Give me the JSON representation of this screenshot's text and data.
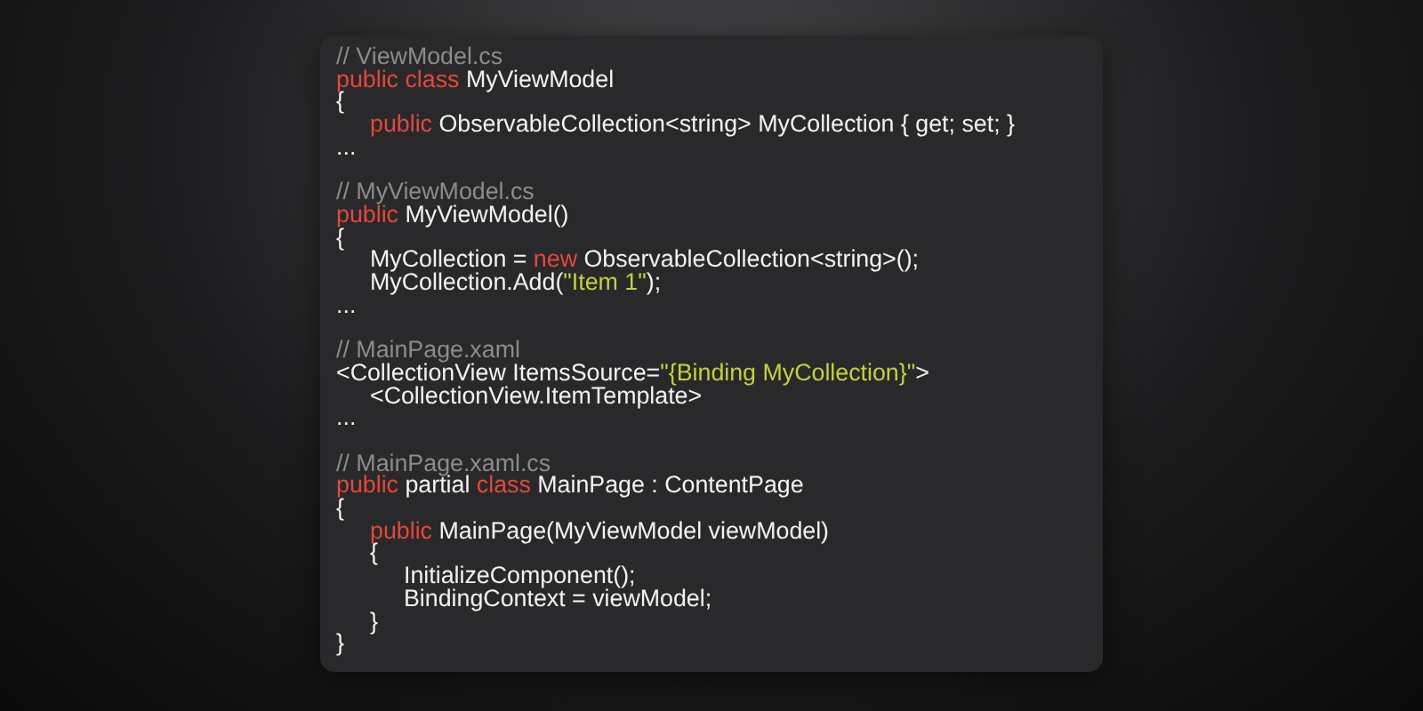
{
  "snippets": [
    {
      "lines": [
        {
          "tokens": [
            {
              "kind": "comment",
              "text": "// ViewModel.cs"
            }
          ]
        },
        {
          "tokens": [
            {
              "kind": "keyword",
              "text": "public class"
            },
            {
              "kind": "plain",
              "text": " MyViewModel"
            }
          ]
        },
        {
          "tokens": [
            {
              "kind": "plain",
              "text": "{"
            }
          ],
          "children": [
            {
              "tokens": [
                {
                  "kind": "keyword",
                  "text": "public"
                },
                {
                  "kind": "plain",
                  "text": " ObservableCollection<string> MyCollection { get; set; }"
                }
              ]
            }
          ]
        },
        {
          "tokens": [
            {
              "kind": "plain",
              "text": "..."
            }
          ]
        }
      ]
    },
    {
      "lines": [
        {
          "tokens": [
            {
              "kind": "comment",
              "text": "// MyViewModel.cs"
            }
          ]
        },
        {
          "tokens": [
            {
              "kind": "keyword",
              "text": "public"
            },
            {
              "kind": "plain",
              "text": " MyViewModel()"
            }
          ]
        },
        {
          "tokens": [
            {
              "kind": "plain",
              "text": "{"
            }
          ],
          "children": [
            {
              "tokens": [
                {
                  "kind": "plain",
                  "text": "MyCollection = "
                },
                {
                  "kind": "keyword",
                  "text": "new"
                },
                {
                  "kind": "plain",
                  "text": " ObservableCollection<string>();"
                }
              ]
            },
            {
              "tokens": [
                {
                  "kind": "plain",
                  "text": "MyCollection.Add("
                },
                {
                  "kind": "string",
                  "text": "\"Item 1\""
                },
                {
                  "kind": "plain",
                  "text": ");"
                }
              ]
            }
          ]
        },
        {
          "tokens": [
            {
              "kind": "plain",
              "text": "..."
            }
          ]
        }
      ]
    },
    {
      "lines": [
        {
          "tokens": [
            {
              "kind": "comment",
              "text": "// MainPage.xaml"
            }
          ]
        },
        {
          "tokens": [
            {
              "kind": "plain",
              "text": "<CollectionView ItemsSource="
            },
            {
              "kind": "string",
              "text": "\"{Binding MyCollection}\""
            },
            {
              "kind": "plain",
              "text": ">"
            }
          ],
          "children": [
            {
              "tokens": [
                {
                  "kind": "plain",
                  "text": "<CollectionView.ItemTemplate>"
                }
              ]
            }
          ]
        },
        {
          "tokens": [
            {
              "kind": "plain",
              "text": "..."
            }
          ]
        }
      ]
    },
    {
      "lines": [
        {
          "tokens": [
            {
              "kind": "comment",
              "text": "// MainPage.xaml.cs"
            }
          ]
        },
        {
          "tokens": [
            {
              "kind": "keyword",
              "text": "public"
            },
            {
              "kind": "plain",
              "text": " partial "
            },
            {
              "kind": "keyword",
              "text": "class"
            },
            {
              "kind": "plain",
              "text": " MainPage : ContentPage"
            }
          ]
        },
        {
          "tokens": [
            {
              "kind": "plain",
              "text": "{"
            }
          ],
          "children": [
            {
              "tokens": [
                {
                  "kind": "keyword",
                  "text": "public"
                },
                {
                  "kind": "plain",
                  "text": " MainPage(MyViewModel viewModel)"
                }
              ]
            },
            {
              "tokens": [
                {
                  "kind": "plain",
                  "text": "{"
                }
              ],
              "children": [
                {
                  "tokens": [
                    {
                      "kind": "plain",
                      "text": "InitializeComponent();"
                    }
                  ]
                },
                {
                  "tokens": [
                    {
                      "kind": "plain",
                      "text": "BindingContext = viewModel;"
                    }
                  ]
                }
              ]
            },
            {
              "tokens": [
                {
                  "kind": "plain",
                  "text": "}"
                }
              ]
            }
          ]
        },
        {
          "tokens": [
            {
              "kind": "plain",
              "text": "}"
            }
          ]
        }
      ]
    }
  ]
}
